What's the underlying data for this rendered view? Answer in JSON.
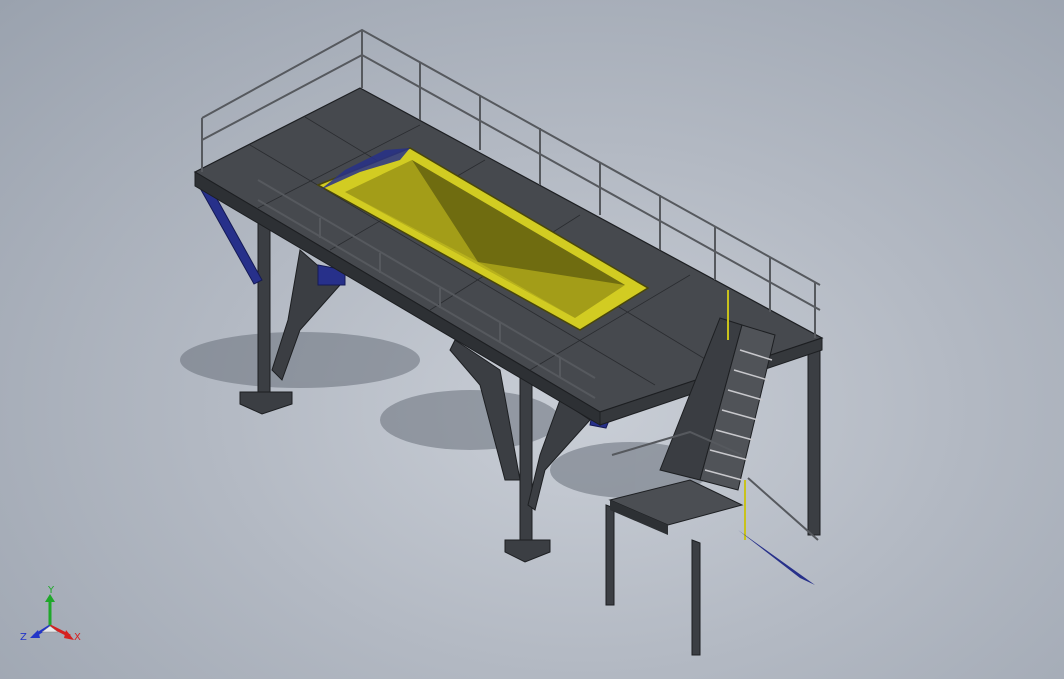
{
  "viewport": {
    "background_colors": [
      "#c9ced6",
      "#9aa2ae"
    ],
    "model_colors": {
      "steel": "#4a4d52",
      "steel_dark": "#2f3236",
      "brace_blue": "#27308a",
      "hopper_yellow": "#c8c21c",
      "hopper_olive": "#7d7a12",
      "rail": "#5a5d62"
    }
  },
  "triad": {
    "x_label": "X",
    "y_label": "Y",
    "z_label": "Z",
    "x_color": "#d62020",
    "y_color": "#1fa82a",
    "z_color": "#2235c8"
  }
}
